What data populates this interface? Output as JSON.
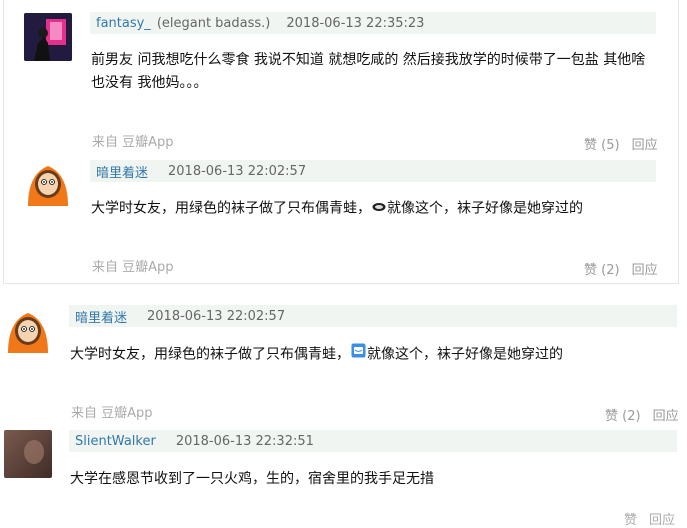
{
  "comments": [
    {
      "user": "fantasy_",
      "signature": "(elegant badass.)",
      "time": "2018-06-13 22:35:23",
      "text_line1": "前男友 问我想吃什么零食 我说不知道 就想吃咸的 然后接我放学的时候带了一包盐 其他啥",
      "text_line2": "也没有 我他妈。。。",
      "source": "来自 豆瓣App",
      "like_label": "赞 (5)",
      "reply_label": "回应"
    },
    {
      "user": "暗里着迷",
      "time": "2018-06-13 22:02:57",
      "text_before": "大学时女友，用绿色的袜子做了只布偶青蛙，",
      "text_after": "就像这个，袜子好像是她穿过的",
      "source": "来自 豆瓣App",
      "like_label": "赞 (2)",
      "reply_label": "回应"
    },
    {
      "user": "暗里着迷",
      "time": "2018-06-13 22:02:57",
      "text_before": "大学时女友，用绿色的袜子做了只布偶青蛙，",
      "text_after": "就像这个，袜子好像是她穿过的",
      "source": "来自 豆瓣App",
      "like_label": "赞 (2)",
      "reply_label": "回应"
    },
    {
      "user": "SlientWalker",
      "time": "2018-06-13 22:32:51",
      "text": "大学在感恩节收到了一只火鸡，生的，宿舍里的我手足无措",
      "like_label": "赞",
      "reply_label": "回应"
    }
  ],
  "colors": {
    "username": "#3377aa",
    "meta_bar_bg": "#f0f5f2",
    "muted": "#aaaaaa"
  }
}
